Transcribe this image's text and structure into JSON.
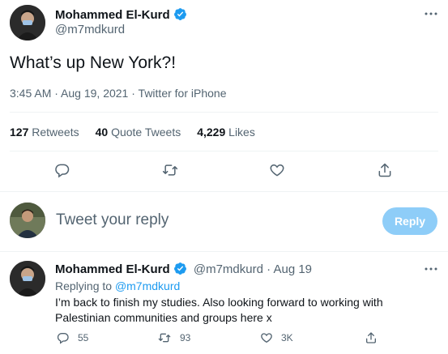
{
  "main_tweet": {
    "author_name": "Mohammed El-Kurd",
    "author_handle": "@m7mdkurd",
    "text": "What’s up New York?!",
    "meta_time": "3:45 AM",
    "meta_date": "Aug 19, 2021",
    "meta_source": "Twitter for iPhone",
    "stats": {
      "retweets_count": "127",
      "retweets_label": "Retweets",
      "quotes_count": "40",
      "quotes_label": "Quote Tweets",
      "likes_count": "4,229",
      "likes_label": "Likes"
    }
  },
  "composer": {
    "placeholder": "Tweet your reply",
    "button_label": "Reply"
  },
  "reply_tweet": {
    "author_name": "Mohammed El-Kurd",
    "author_handle": "@m7mdkurd",
    "date": "Aug 19",
    "replying_prefix": "Replying to",
    "replying_to": "@m7mdkurd",
    "text": "I’m back to finish my studies. Also looking forward to working with Palestinian communities and groups here x",
    "replies_count": "55",
    "retweets_count": "93",
    "likes_count": "3K"
  },
  "colors": {
    "accent": "#1d9bf0",
    "reply_button_disabled": "#8ecdf8",
    "secondary_text": "#536471"
  }
}
